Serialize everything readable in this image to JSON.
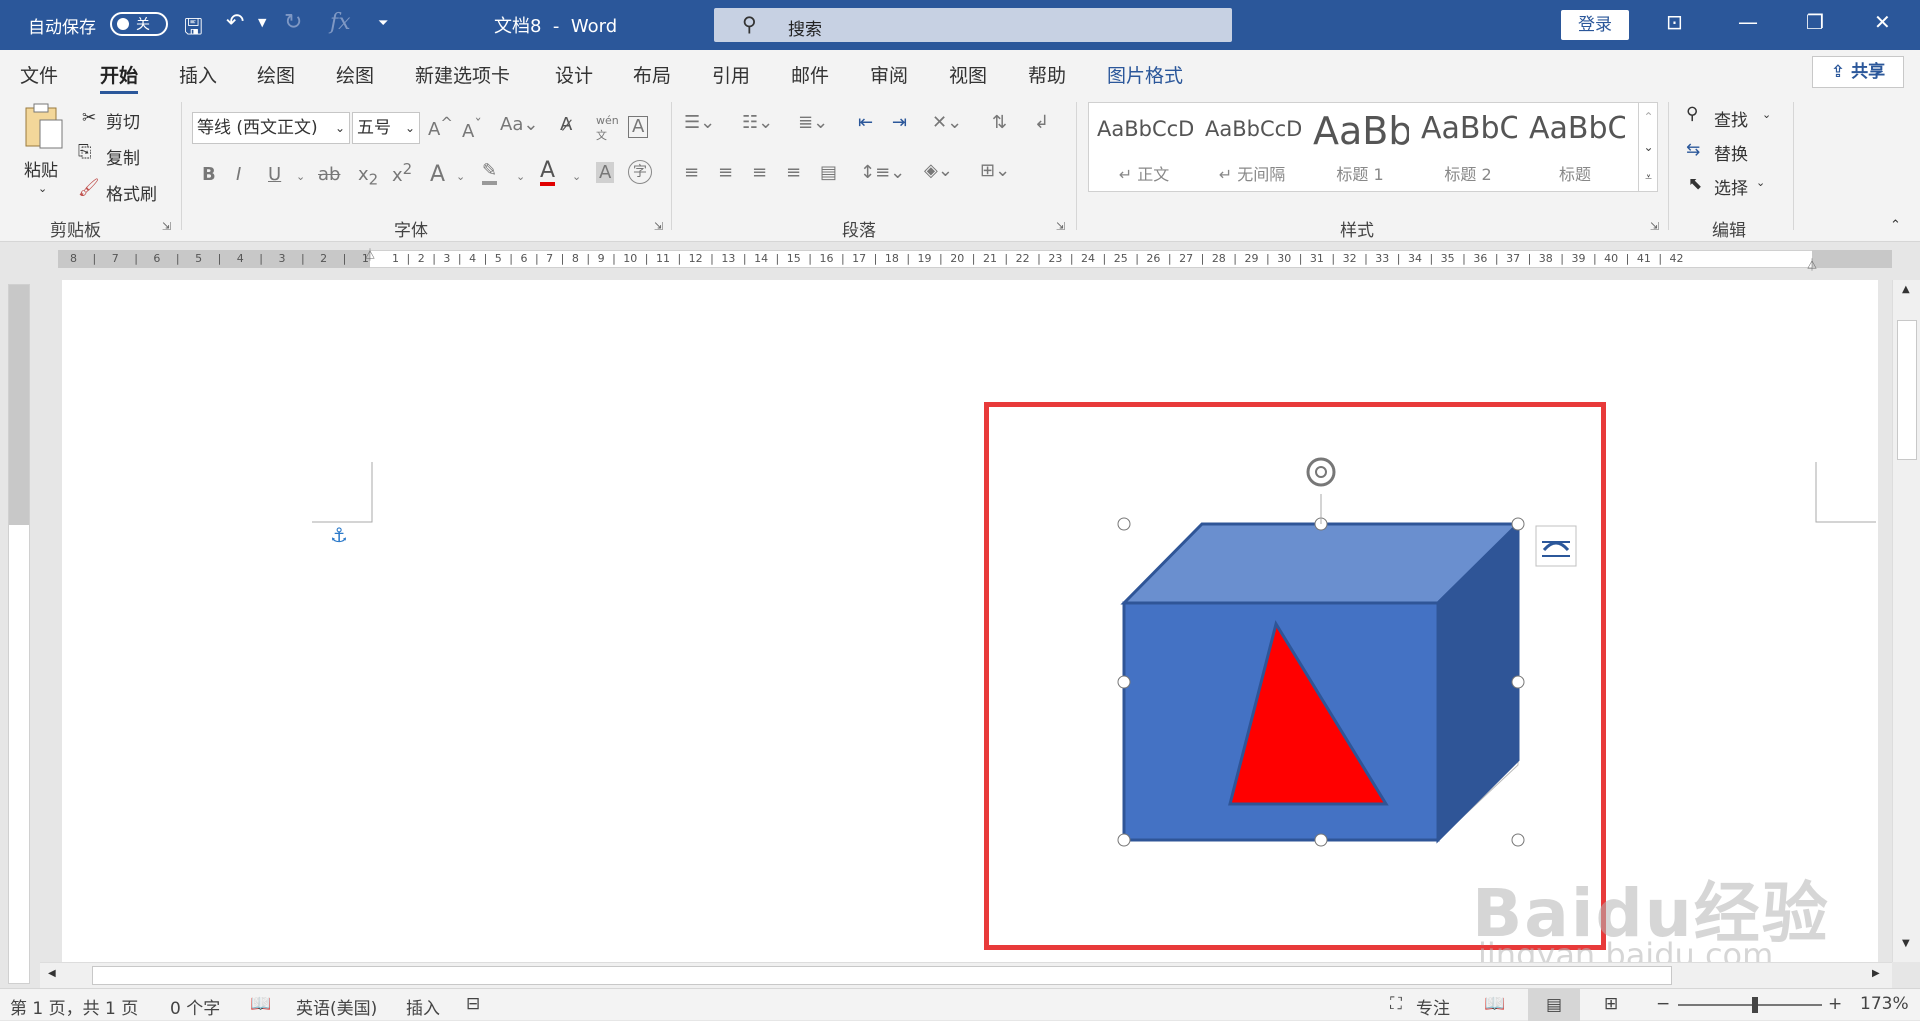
{
  "titlebar": {
    "autosave_label": "自动保存",
    "autosave_state": "关",
    "doc_name": "文档8",
    "app_name": "Word",
    "search_placeholder": "搜索",
    "login_label": "登录"
  },
  "menu": {
    "tabs": [
      "文件",
      "开始",
      "插入",
      "绘图",
      "绘图",
      "新建选项卡",
      "设计",
      "布局",
      "引用",
      "邮件",
      "审阅",
      "视图",
      "帮助",
      "图片格式"
    ],
    "active_index": 1,
    "share_label": "共享"
  },
  "ribbon": {
    "clipboard": {
      "paste": "粘贴",
      "cut": "剪切",
      "copy": "复制",
      "format_painter": "格式刷",
      "group": "剪贴板"
    },
    "font": {
      "family": "等线 (西文正文)",
      "size": "五号",
      "group": "字体"
    },
    "paragraph": {
      "group": "段落"
    },
    "styles": {
      "group": "样式",
      "tiles": [
        {
          "sample": "AaBbCcDc",
          "name": "↵ 正文"
        },
        {
          "sample": "AaBbCcDc",
          "name": "↵ 无间隔"
        },
        {
          "sample": "AaBb",
          "name": "标题 1"
        },
        {
          "sample": "AaBbC",
          "name": "标题 2"
        },
        {
          "sample": "AaBbC",
          "name": "标题"
        }
      ]
    },
    "editing": {
      "find": "查找",
      "replace": "替换",
      "select": "选择",
      "group": "编辑"
    }
  },
  "ruler": {
    "left_numbers": "8 | 7 | 6 | 5 | 4 | 3 | 2 | 1",
    "right_numbers": "1 | 2 | 3 | 4 | 5 | 6 | 7 | 8 | 9 | 10 | 11 | 12 | 13 | 14 | 15 | 16 | 17 | 18 | 19 | 20 | 21 | 22 | 23 | 24 | 25 | 26 | 27 | 28 | 29 | 30 | 31 | 32 | 33 | 34 | 35 | 36 | 37 | 38 | 39 | 40 | 41 | 42"
  },
  "status": {
    "page": "第 1 页，共 1 页",
    "words": "0 个字",
    "language": "英语(美国)",
    "mode": "插入",
    "focus": "专注",
    "zoom": "173%"
  },
  "watermark": {
    "brand": "Baidu经验",
    "url": "jingyan.baidu.com"
  },
  "colors": {
    "brand": "#2b579a",
    "cube_front": "#4472c4",
    "cube_top": "#6a8fcf",
    "cube_side": "#2f5597",
    "triangle": "#ff0000",
    "highlight_box": "#e83a3a"
  }
}
